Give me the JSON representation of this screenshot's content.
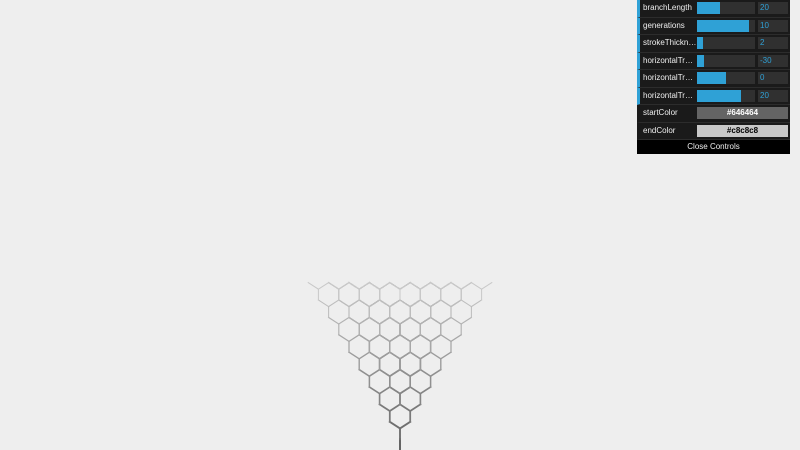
{
  "gui": {
    "controls": [
      {
        "label": "branchLength",
        "value": "20",
        "fill": 0.4
      },
      {
        "label": "generations",
        "value": "10",
        "fill": 0.9
      },
      {
        "label": "strokeThickness",
        "value": "2",
        "fill": 0.1
      },
      {
        "label": "horizontalTravel...",
        "value": "-30",
        "fill": 0.12
      },
      {
        "label": "horizontalTravel...",
        "value": "0",
        "fill": 0.5
      },
      {
        "label": "horizontalTravel...",
        "value": "20",
        "fill": 0.75
      }
    ],
    "start_color": {
      "label": "startColor",
      "value": "#646464",
      "hex": "#646464"
    },
    "end_color": {
      "label": "endColor",
      "value": "#c8c8c8",
      "hex": "#c8c8c8"
    },
    "close_label": "Close Controls",
    "accent": "#2fa1d6"
  },
  "tree": {
    "branch_length": 20,
    "generations": 10,
    "stroke_thickness": 2,
    "start_color": "#646464",
    "end_color": "#c8c8c8"
  }
}
